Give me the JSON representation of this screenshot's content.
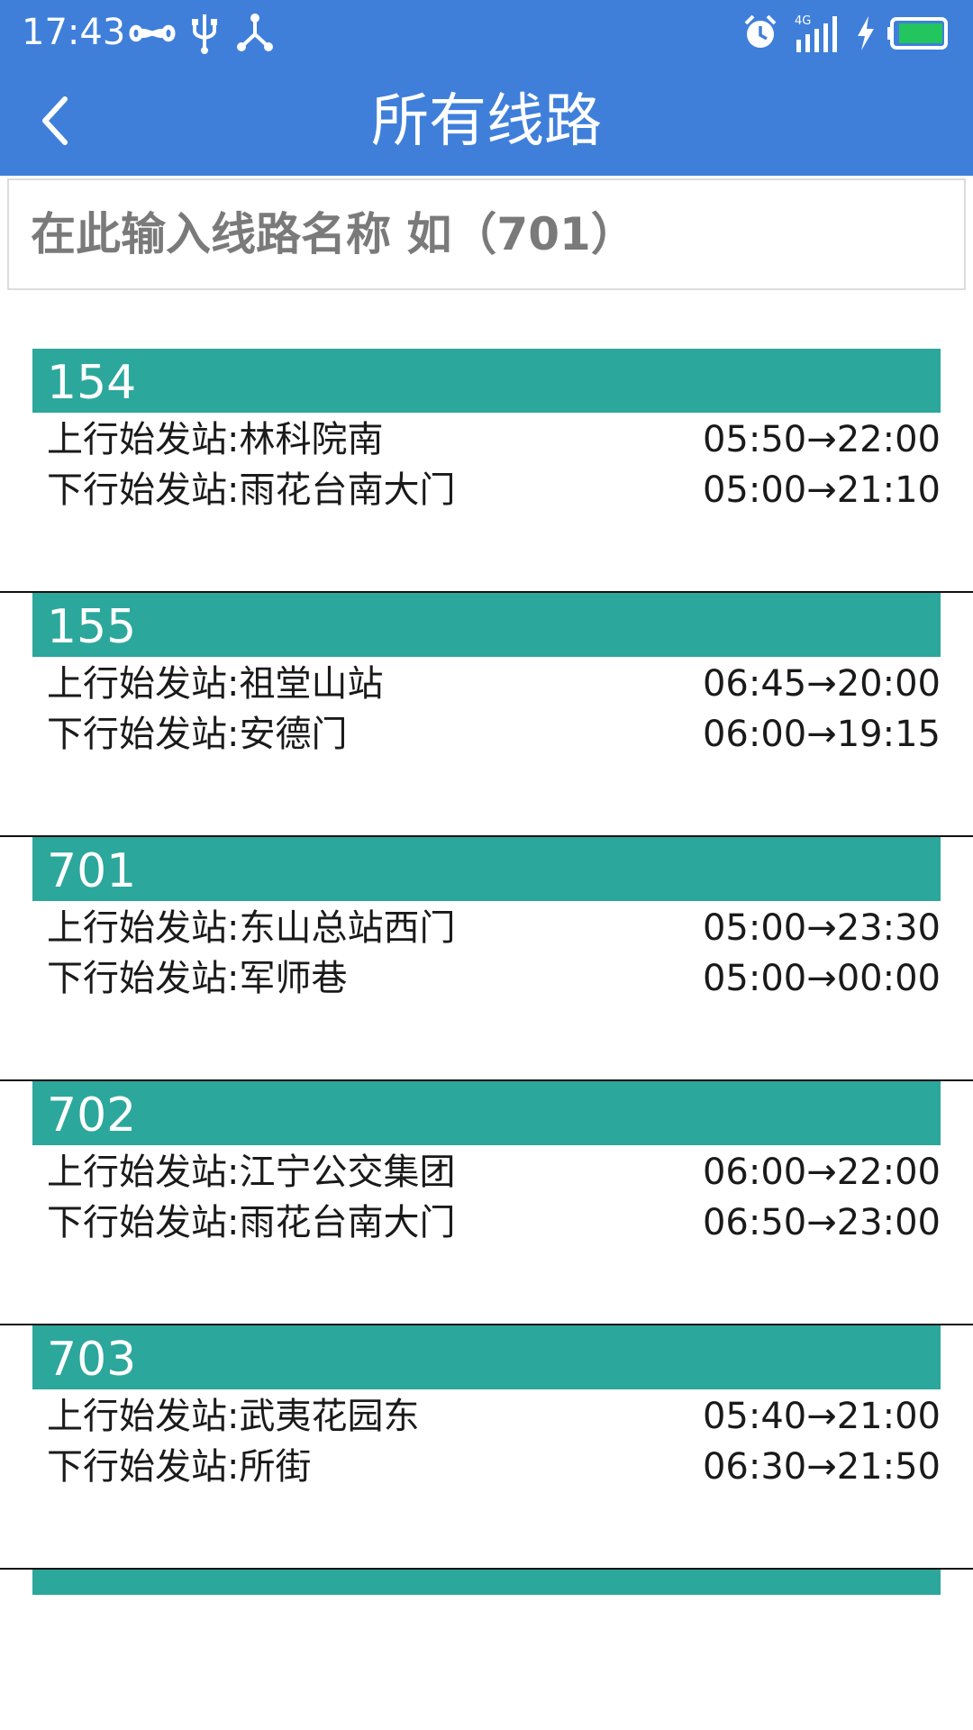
{
  "status_bar": {
    "time": "17:43",
    "icons": [
      "infinity-icon",
      "usb-icon",
      "share-icon",
      "alarm-icon",
      "signal-4g-icon",
      "charging-icon",
      "battery-icon"
    ],
    "network": "4G"
  },
  "header": {
    "title": "所有线路",
    "background": "#3f7fda"
  },
  "search": {
    "placeholder": "在此输入线路名称 如（701）",
    "value": ""
  },
  "colors": {
    "route_header": "#2ca79c",
    "divider": "#111111"
  },
  "routes": [
    {
      "number": "154",
      "up_label": "上行始发站:林科院南",
      "up_time": "05:50→22:00",
      "down_label": "下行始发站:雨花台南大门",
      "down_time": "05:00→21:10"
    },
    {
      "number": "155",
      "up_label": "上行始发站:祖堂山站",
      "up_time": "06:45→20:00",
      "down_label": "下行始发站:安德门",
      "down_time": "06:00→19:15"
    },
    {
      "number": "701",
      "up_label": "上行始发站:东山总站西门",
      "up_time": "05:00→23:30",
      "down_label": "下行始发站:军师巷",
      "down_time": "05:00→00:00"
    },
    {
      "number": "702",
      "up_label": "上行始发站:江宁公交集团",
      "up_time": "06:00→22:00",
      "down_label": "下行始发站:雨花台南大门",
      "down_time": "06:50→23:00"
    },
    {
      "number": "703",
      "up_label": "上行始发站:武夷花园东",
      "up_time": "05:40→21:00",
      "down_label": "下行始发站:所街",
      "down_time": "06:30→21:50"
    }
  ]
}
